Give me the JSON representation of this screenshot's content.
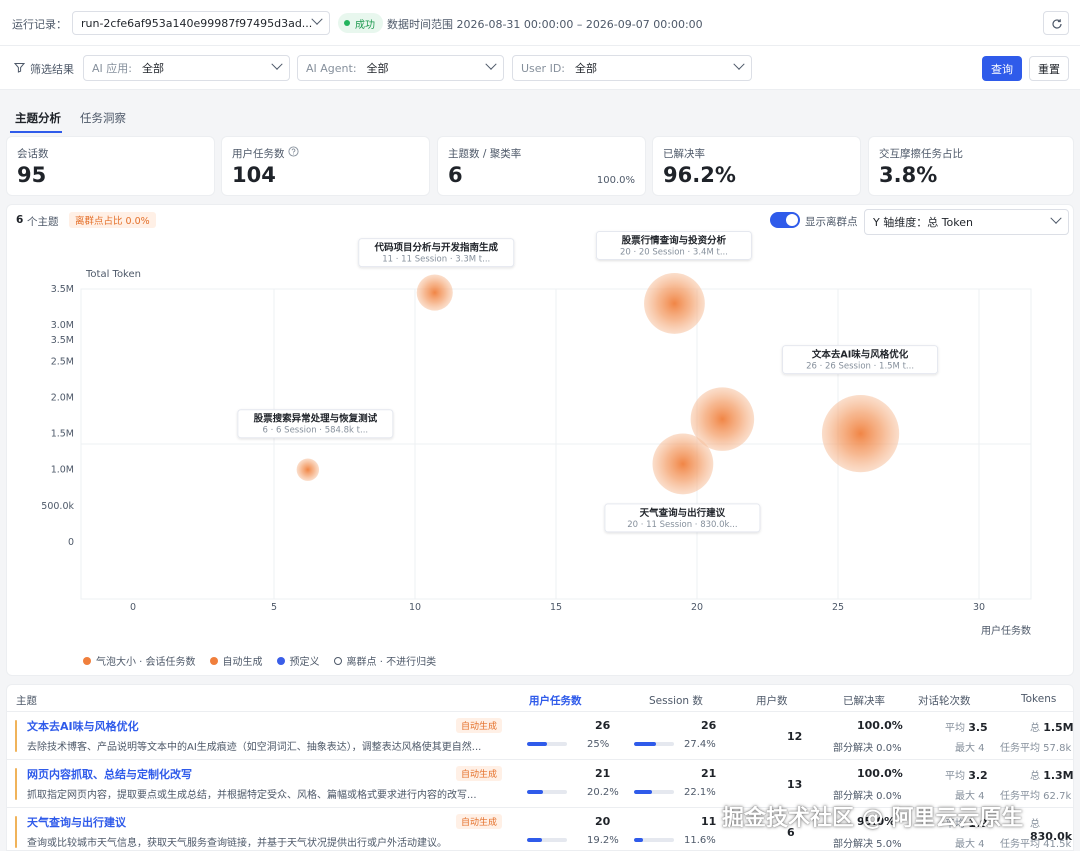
{
  "toolbar": {
    "run_label": "运行记录：",
    "run_value": "run-2cfe6af953a140e99987f97495d3ad...",
    "status": "成功",
    "range": "数据时间范围 2026-08-31 00:00:00 – 2026-09-07 00:00:00"
  },
  "filters": {
    "label": "筛选结果",
    "app_prefix": "AI 应用:",
    "app_value": "全部",
    "agent_prefix": "AI Agent:",
    "agent_value": "全部",
    "user_prefix": "User ID:",
    "user_value": "全部",
    "query": "查询",
    "reset": "重置"
  },
  "tabs": [
    "主题分析",
    "任务洞察"
  ],
  "stats": [
    {
      "title": "会话数",
      "value": "95",
      "sub": ""
    },
    {
      "title": "用户任务数",
      "value": "104",
      "sub": ""
    },
    {
      "title": "主题数 / 聚类率",
      "value": "6",
      "sub": "100.0%"
    },
    {
      "title": "已解决率",
      "value": "96.2%",
      "sub": ""
    },
    {
      "title": "交互摩擦任务占比",
      "value": "3.8%",
      "sub": ""
    }
  ],
  "panel": {
    "topic_count": "6",
    "topic_suffix": "个主题",
    "outlier_badge": "离群点占比 0.0%",
    "toggle_label": "显示离群点",
    "yaxis_select": "Y 轴维度：总 Token"
  },
  "chart_data": {
    "type": "scatter",
    "xlabel": "用户任务数",
    "ylabel": "Total Token",
    "xlim": [
      0,
      30
    ],
    "ylim": [
      0,
      3500000
    ],
    "xticks": [
      "0",
      "5",
      "10",
      "15",
      "20",
      "25",
      "30"
    ],
    "yticks": [
      "0",
      "500.0k",
      "1.0M",
      "1.5M",
      "2.0M",
      "2.5M",
      "3.0M",
      "3.5M"
    ],
    "ytick_values": [
      0,
      500000,
      1000000,
      1500000,
      2000000,
      2500000,
      3000000,
      3500000
    ],
    "points": [
      {
        "name": "代码项目分析与开发指南生成",
        "detail": "11 · 11 Session · 3.3M t...",
        "x": 10.7,
        "y": 3450000,
        "size": 11
      },
      {
        "name": "股票行情查询与投资分析",
        "detail": "20 · 20 Session · 3.4M t...",
        "x": 19.2,
        "y": 3300000,
        "size": 20
      },
      {
        "name": "文本去AI味与风格优化",
        "detail": "26 · 26 Session · 1.5M t...",
        "x": 25.8,
        "y": 1500000,
        "size": 26
      },
      {
        "name": "股票搜索异常处理与恢复测试",
        "detail": "6 · 6 Session · 584.8k t...",
        "x": 6.2,
        "y": 1000000,
        "size": 6
      },
      {
        "name": "",
        "detail": "",
        "x": 20.9,
        "y": 1700000,
        "size": 21
      },
      {
        "name": "天气查询与出行建议",
        "detail": "20 · 11 Session · 830.0k...",
        "x": 19.5,
        "y": 1080000,
        "size": 20
      }
    ],
    "legend": [
      "气泡大小 · 会话任务数",
      "自动生成",
      "预定义",
      "离群点 · 不进行归类"
    ],
    "colors": {
      "auto": "#f07f3c",
      "predefined": "#3a5ee8",
      "outlier": "#ffffff"
    }
  },
  "table": {
    "headers": [
      "主题",
      "用户任务数",
      "Session 数",
      "用户数",
      "已解决率",
      "对话轮次数",
      "Tokens"
    ],
    "rows": [
      {
        "title": "文本去AI味与风格优化",
        "desc": "去除技术博客、产品说明等文本中的AI生成痕迹（如空洞词汇、抽象表达），调整表达风格使其更自然...",
        "tag": "自动生成",
        "tasks": "26",
        "tasks_pct": "25%",
        "tasks_frac": 0.25,
        "sessions": "26",
        "sessions_pct": "27.4%",
        "sessions_frac": 0.274,
        "users": "12",
        "resolved": "100.0%",
        "partial": "部分解决 0.0%",
        "avg_label": "平均",
        "avg": "3.5",
        "max": "最大 4",
        "tok_label": "总",
        "tok_total": "1.5M",
        "tok_avg": "任务平均 57.8k"
      },
      {
        "title": "网页内容抓取、总结与定制化改写",
        "desc": "抓取指定网页内容，提取要点或生成总结，并根据特定受众、风格、篇幅或格式要求进行内容的改写...",
        "tag": "自动生成",
        "tasks": "21",
        "tasks_pct": "20.2%",
        "tasks_frac": 0.202,
        "sessions": "21",
        "sessions_pct": "22.1%",
        "sessions_frac": 0.221,
        "users": "13",
        "resolved": "100.0%",
        "partial": "部分解决 0.0%",
        "avg_label": "平均",
        "avg": "3.2",
        "max": "最大 4",
        "tok_label": "总",
        "tok_total": "1.3M",
        "tok_avg": "任务平均 62.7k"
      },
      {
        "title": "天气查询与出行建议",
        "desc": "查询或比较城市天气信息，获取天气服务查询链接，并基于天气状况提供出行或户外活动建议。",
        "tag": "自动生成",
        "tasks": "20",
        "tasks_pct": "19.2%",
        "tasks_frac": 0.192,
        "sessions": "11",
        "sessions_pct": "11.6%",
        "sessions_frac": 0.116,
        "users": "6",
        "resolved": "95.0%",
        "partial": "部分解决 5.0%",
        "avg_label": "平均",
        "avg": "1.9",
        "max": "最大 4",
        "tok_label": "总",
        "tok_total": "830.0k",
        "tok_avg": "任务平均 41.5k"
      }
    ]
  },
  "watermark": "掘金技术社区 @ 阿里云云原生"
}
